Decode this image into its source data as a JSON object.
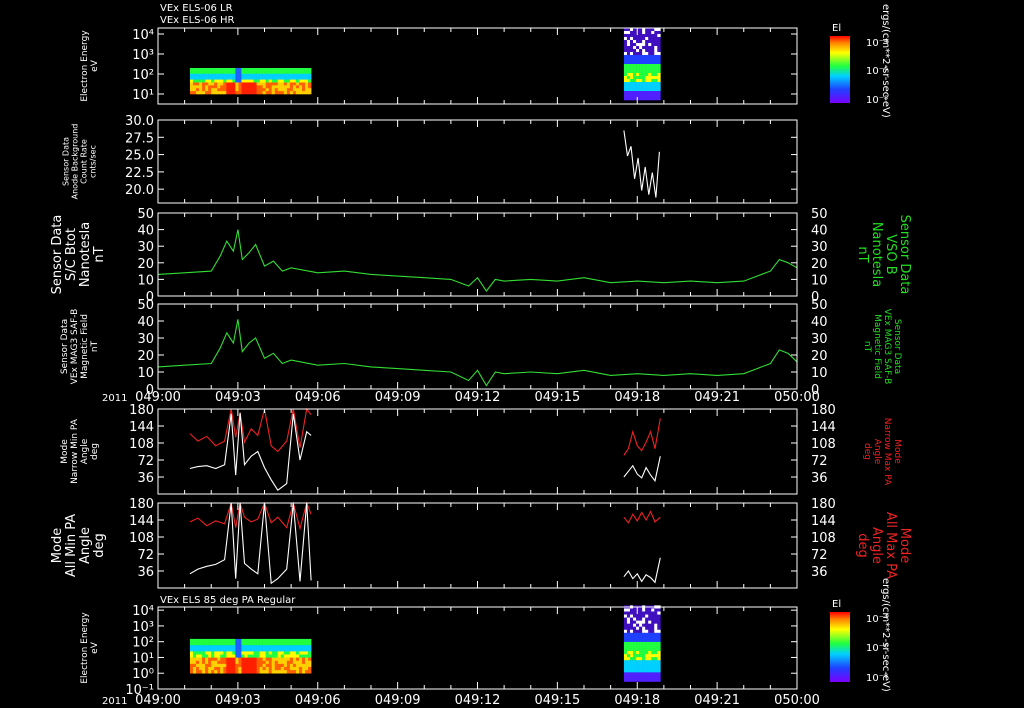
{
  "panel_titles": {
    "top": [
      "VEx ELS-06 LR",
      "VEx ELS-06 HR"
    ],
    "bottom": "VEx ELS 85 deg PA Regular"
  },
  "year_label": "2011",
  "time_ticks": [
    "049:00",
    "049:03",
    "049:06",
    "049:09",
    "049:12",
    "049:15",
    "049:18",
    "049:21",
    "050:00"
  ],
  "colorbar": {
    "label": "El",
    "unit": "ergs/(cm**2-sr-sec-eV)",
    "tick_labels": [
      "10⁻⁴",
      "10⁻⁶",
      "10⁻⁸"
    ]
  },
  "colors": {
    "background": "#000000",
    "axis": "#ffffff",
    "green_trace": "#33dd33",
    "red_trace": "#ee2222",
    "white_trace": "#ffffff",
    "right_label_green": "#22dd22",
    "right_label_red": "#ee2222"
  },
  "chart_data": [
    {
      "type": "heatmap",
      "id": "spec1",
      "ylabel": [
        "Electron Energy",
        "eV"
      ],
      "ytick_labels": [
        "10⁴",
        "10³",
        "10²",
        "10¹"
      ],
      "ytick_values": [
        10000,
        1000,
        100,
        10
      ],
      "ylim_log10": [
        0.5,
        4.3
      ],
      "blocks": [
        {
          "t_start": "049:01:12",
          "t_end": "049:05:45",
          "e_low": 10,
          "e_high": 200,
          "profile": "lr"
        },
        {
          "t_start": "049:17:30",
          "t_end": "049:18:52",
          "e_low": 5,
          "e_high": 20000,
          "profile": "hr"
        }
      ]
    },
    {
      "type": "line",
      "id": "bkg",
      "ylabel": [
        "Sensor Data",
        "Anode Background",
        "Count Rate",
        "cnts/sec"
      ],
      "ytick_labels": [
        "30.0",
        "27.5",
        "25.0",
        "22.5",
        "20.0"
      ],
      "ytick_values": [
        30,
        27.5,
        25,
        22.5,
        20
      ],
      "ylim": [
        18,
        30
      ],
      "series": [
        {
          "color": "white",
          "t": [
            "049:17:30",
            "049:17:38",
            "049:17:46",
            "049:17:54",
            "049:18:02",
            "049:18:10",
            "049:18:18",
            "049:18:26",
            "049:18:34",
            "049:18:42",
            "049:18:50"
          ],
          "v": [
            28.5,
            24.8,
            26.2,
            21.5,
            24.5,
            19.8,
            23.2,
            19.2,
            22.4,
            18.8,
            25.4
          ]
        }
      ]
    },
    {
      "type": "line",
      "id": "bmag1",
      "ylabel": [
        "Sensor Data",
        "S/C Btot",
        "Nanotesla",
        "nT"
      ],
      "right_label": [
        "Sensor Data",
        "VSO B",
        "Nanotesla",
        "nT"
      ],
      "ytick_labels": [
        "50",
        "40",
        "30",
        "20",
        "10",
        "0"
      ],
      "ytick_values": [
        50,
        40,
        30,
        20,
        10,
        0
      ],
      "ylim": [
        0,
        50
      ],
      "series": [
        {
          "color": "green",
          "t": [
            "049:00:00",
            "049:01:00",
            "049:02:00",
            "049:02:20",
            "049:02:35",
            "049:02:50",
            "049:03:00",
            "049:03:10",
            "049:03:25",
            "049:03:40",
            "049:04:00",
            "049:04:20",
            "049:04:40",
            "049:05:00",
            "049:06:00",
            "049:07:00",
            "049:08:00",
            "049:09:00",
            "049:10:00",
            "049:11:00",
            "049:11:40",
            "049:12:00",
            "049:12:20",
            "049:12:40",
            "049:13:00",
            "049:14:00",
            "049:15:00",
            "049:16:00",
            "049:17:00",
            "049:18:00",
            "049:19:00",
            "049:20:00",
            "049:21:00",
            "049:22:00",
            "049:22:30",
            "049:23:00",
            "049:23:20",
            "049:23:40",
            "050:00:00"
          ],
          "v": [
            13,
            14,
            15,
            24,
            33,
            27,
            40,
            22,
            26,
            31,
            18,
            21,
            15,
            17,
            14,
            15,
            13,
            12,
            11,
            10,
            6,
            11,
            3,
            10,
            9,
            10,
            9,
            11,
            8,
            9,
            8,
            9,
            8,
            9,
            12,
            15,
            22,
            20,
            17
          ]
        }
      ]
    },
    {
      "type": "line",
      "id": "bmag2",
      "ylabel": [
        "Sensor Data",
        "VEx MAG3 SAF-B",
        "Magnetic Field",
        "nT"
      ],
      "right_label": [
        "Sensor Data",
        "VEx MAG3 SAF-B",
        "Magnetic Field",
        "nT"
      ],
      "ytick_labels": [
        "50",
        "40",
        "30",
        "20",
        "10",
        "0"
      ],
      "ytick_values": [
        50,
        40,
        30,
        20,
        10,
        0
      ],
      "ylim": [
        0,
        50
      ],
      "series": [
        {
          "color": "green",
          "t": [
            "049:00:00",
            "049:01:00",
            "049:02:00",
            "049:02:20",
            "049:02:35",
            "049:02:50",
            "049:03:00",
            "049:03:10",
            "049:03:25",
            "049:03:40",
            "049:04:00",
            "049:04:20",
            "049:04:40",
            "049:05:00",
            "049:06:00",
            "049:07:00",
            "049:08:00",
            "049:09:00",
            "049:10:00",
            "049:11:00",
            "049:11:40",
            "049:12:00",
            "049:12:20",
            "049:12:40",
            "049:13:00",
            "049:14:00",
            "049:15:00",
            "049:16:00",
            "049:17:00",
            "049:18:00",
            "049:19:00",
            "049:20:00",
            "049:21:00",
            "049:22:00",
            "049:22:30",
            "049:23:00",
            "049:23:20",
            "049:23:40",
            "050:00:00"
          ],
          "v": [
            13,
            14,
            15,
            24,
            33,
            27,
            41,
            22,
            27,
            30,
            18,
            21,
            15,
            17,
            14,
            15,
            13,
            12,
            11,
            10,
            5,
            11,
            2,
            10,
            9,
            10,
            9,
            11,
            8,
            9,
            8,
            9,
            8,
            9,
            12,
            15,
            23,
            21,
            16
          ]
        }
      ]
    },
    {
      "type": "line",
      "id": "pa1",
      "ylabel": [
        "Mode",
        "Narrow Min PA",
        "Angle",
        "deg"
      ],
      "right_label": [
        "Mode",
        "Narrow Max PA",
        "Angle",
        "deg"
      ],
      "ytick_labels": [
        "180",
        "144",
        "108",
        "72",
        "36"
      ],
      "ytick_values": [
        180,
        144,
        108,
        72,
        36
      ],
      "ylim": [
        0,
        180
      ],
      "series": [
        {
          "color": "red",
          "t": [
            "049:01:12",
            "049:01:30",
            "049:01:50",
            "049:02:10",
            "049:02:30",
            "049:02:45",
            "049:02:55",
            "049:03:05",
            "049:03:15",
            "049:03:30",
            "049:03:45",
            "049:04:00",
            "049:04:15",
            "049:04:30",
            "049:04:50",
            "049:05:05",
            "049:05:20",
            "049:05:35",
            "049:05:45"
          ],
          "v": [
            128,
            112,
            122,
            102,
            112,
            180,
            120,
            172,
            110,
            138,
            124,
            180,
            102,
            90,
            112,
            180,
            98,
            180,
            168
          ]
        },
        {
          "color": "white",
          "t": [
            "049:01:12",
            "049:01:30",
            "049:01:50",
            "049:02:10",
            "049:02:30",
            "049:02:45",
            "049:02:55",
            "049:03:05",
            "049:03:15",
            "049:03:30",
            "049:03:45",
            "049:04:00",
            "049:04:15",
            "049:04:30",
            "049:04:50",
            "049:05:05",
            "049:05:20",
            "049:05:35",
            "049:05:45"
          ],
          "v": [
            54,
            58,
            60,
            54,
            62,
            170,
            40,
            172,
            62,
            80,
            90,
            56,
            30,
            8,
            22,
            170,
            72,
            132,
            124
          ]
        },
        {
          "color": "red",
          "t": [
            "049:17:30",
            "049:17:40",
            "049:17:50",
            "049:18:00",
            "049:18:10",
            "049:18:20",
            "049:18:30",
            "049:18:40",
            "049:18:52"
          ],
          "v": [
            82,
            96,
            132,
            102,
            92,
            110,
            132,
            96,
            160
          ]
        },
        {
          "color": "white",
          "t": [
            "049:17:30",
            "049:17:40",
            "049:17:50",
            "049:18:00",
            "049:18:10",
            "049:18:20",
            "049:18:30",
            "049:18:40",
            "049:18:52"
          ],
          "v": [
            36,
            48,
            60,
            42,
            34,
            56,
            40,
            28,
            80
          ]
        }
      ]
    },
    {
      "type": "line",
      "id": "pa2",
      "ylabel": [
        "Mode",
        "All Min PA",
        "Angle",
        "deg"
      ],
      "right_label": [
        "Mode",
        "All Max PA",
        "Angle",
        "deg"
      ],
      "ytick_labels": [
        "180",
        "144",
        "108",
        "72",
        "36"
      ],
      "ytick_values": [
        180,
        144,
        108,
        72,
        36
      ],
      "ylim": [
        0,
        180
      ],
      "series": [
        {
          "color": "red",
          "t": [
            "049:01:12",
            "049:01:30",
            "049:01:50",
            "049:02:10",
            "049:02:30",
            "049:02:45",
            "049:02:55",
            "049:03:05",
            "049:03:15",
            "049:03:30",
            "049:03:45",
            "049:04:00",
            "049:04:15",
            "049:04:30",
            "049:04:50",
            "049:05:05",
            "049:05:20",
            "049:05:35",
            "049:05:45"
          ],
          "v": [
            140,
            148,
            132,
            142,
            136,
            180,
            128,
            180,
            150,
            140,
            146,
            180,
            138,
            150,
            128,
            180,
            126,
            180,
            156
          ]
        },
        {
          "color": "white",
          "t": [
            "049:01:12",
            "049:01:30",
            "049:01:50",
            "049:02:10",
            "049:02:30",
            "049:02:45",
            "049:02:55",
            "049:03:05",
            "049:03:15",
            "049:03:30",
            "049:03:45",
            "049:04:00",
            "049:04:15",
            "049:04:30",
            "049:04:50",
            "049:05:05",
            "049:05:20",
            "049:05:35",
            "049:05:45"
          ],
          "v": [
            30,
            40,
            46,
            50,
            60,
            180,
            20,
            180,
            52,
            40,
            30,
            180,
            10,
            20,
            40,
            180,
            14,
            180,
            16
          ]
        },
        {
          "color": "red",
          "t": [
            "049:17:30",
            "049:17:40",
            "049:17:50",
            "049:18:00",
            "049:18:10",
            "049:18:20",
            "049:18:30",
            "049:18:40",
            "049:18:52"
          ],
          "v": [
            150,
            138,
            156,
            142,
            160,
            144,
            162,
            140,
            150
          ]
        },
        {
          "color": "white",
          "t": [
            "049:17:30",
            "049:17:40",
            "049:17:50",
            "049:18:00",
            "049:18:10",
            "049:18:20",
            "049:18:30",
            "049:18:40",
            "049:18:52"
          ],
          "v": [
            24,
            36,
            20,
            30,
            14,
            28,
            22,
            12,
            64
          ]
        }
      ]
    },
    {
      "type": "heatmap",
      "id": "spec2",
      "ylabel": [
        "Electron Energy",
        "eV"
      ],
      "ytick_labels": [
        "10⁴",
        "10³",
        "10²",
        "10¹",
        "10⁰",
        "10⁻¹"
      ],
      "ytick_values": [
        10000,
        1000,
        100,
        10,
        1,
        0.1
      ],
      "ylim_log10": [
        -1,
        4.2
      ],
      "blocks": [
        {
          "t_start": "049:01:12",
          "t_end": "049:05:45",
          "e_low": 1,
          "e_high": 150,
          "profile": "lr"
        },
        {
          "t_start": "049:17:30",
          "t_end": "049:18:52",
          "e_low": 0.3,
          "e_high": 20000,
          "profile": "hr"
        }
      ]
    }
  ]
}
